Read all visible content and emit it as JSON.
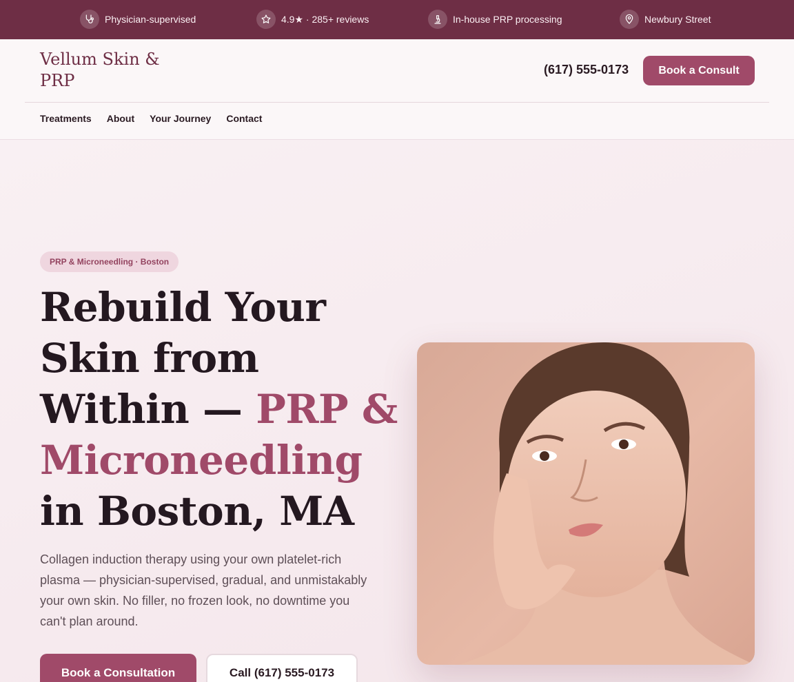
{
  "topbar": {
    "items": [
      {
        "icon": "stethoscope-icon",
        "label": "Physician-supervised"
      },
      {
        "icon": "star-icon",
        "label": "4.9★ · 285+ reviews"
      },
      {
        "icon": "microscope-icon",
        "label": "In-house PRP processing"
      },
      {
        "icon": "map-pin-icon",
        "label": "Newbury Street"
      }
    ]
  },
  "header": {
    "logo": "Vellum Skin & PRP",
    "phone": "(617) 555-0173",
    "cta": "Book a Consult",
    "nav": [
      "Treatments",
      "About",
      "Your Journey",
      "Contact"
    ]
  },
  "hero": {
    "pill": "PRP & Microneedling · Boston",
    "headline_part1": "Rebuild Your Skin from Within —",
    "headline_accent": "PRP & Microneedling",
    "headline_part2": "in Boston, MA",
    "lede": "Collagen induction therapy using your own platelet-rich plasma — physician-supervised, gradual, and unmistakably your own skin. No filler, no frozen look, no downtime you can't plan around.",
    "primary_cta": "Book a Consultation",
    "secondary_cta": "Call (617) 555-0173"
  },
  "colors": {
    "brand_dark": "#6e2e45",
    "brand_accent": "#a04a69",
    "background": "#f7eef1"
  }
}
